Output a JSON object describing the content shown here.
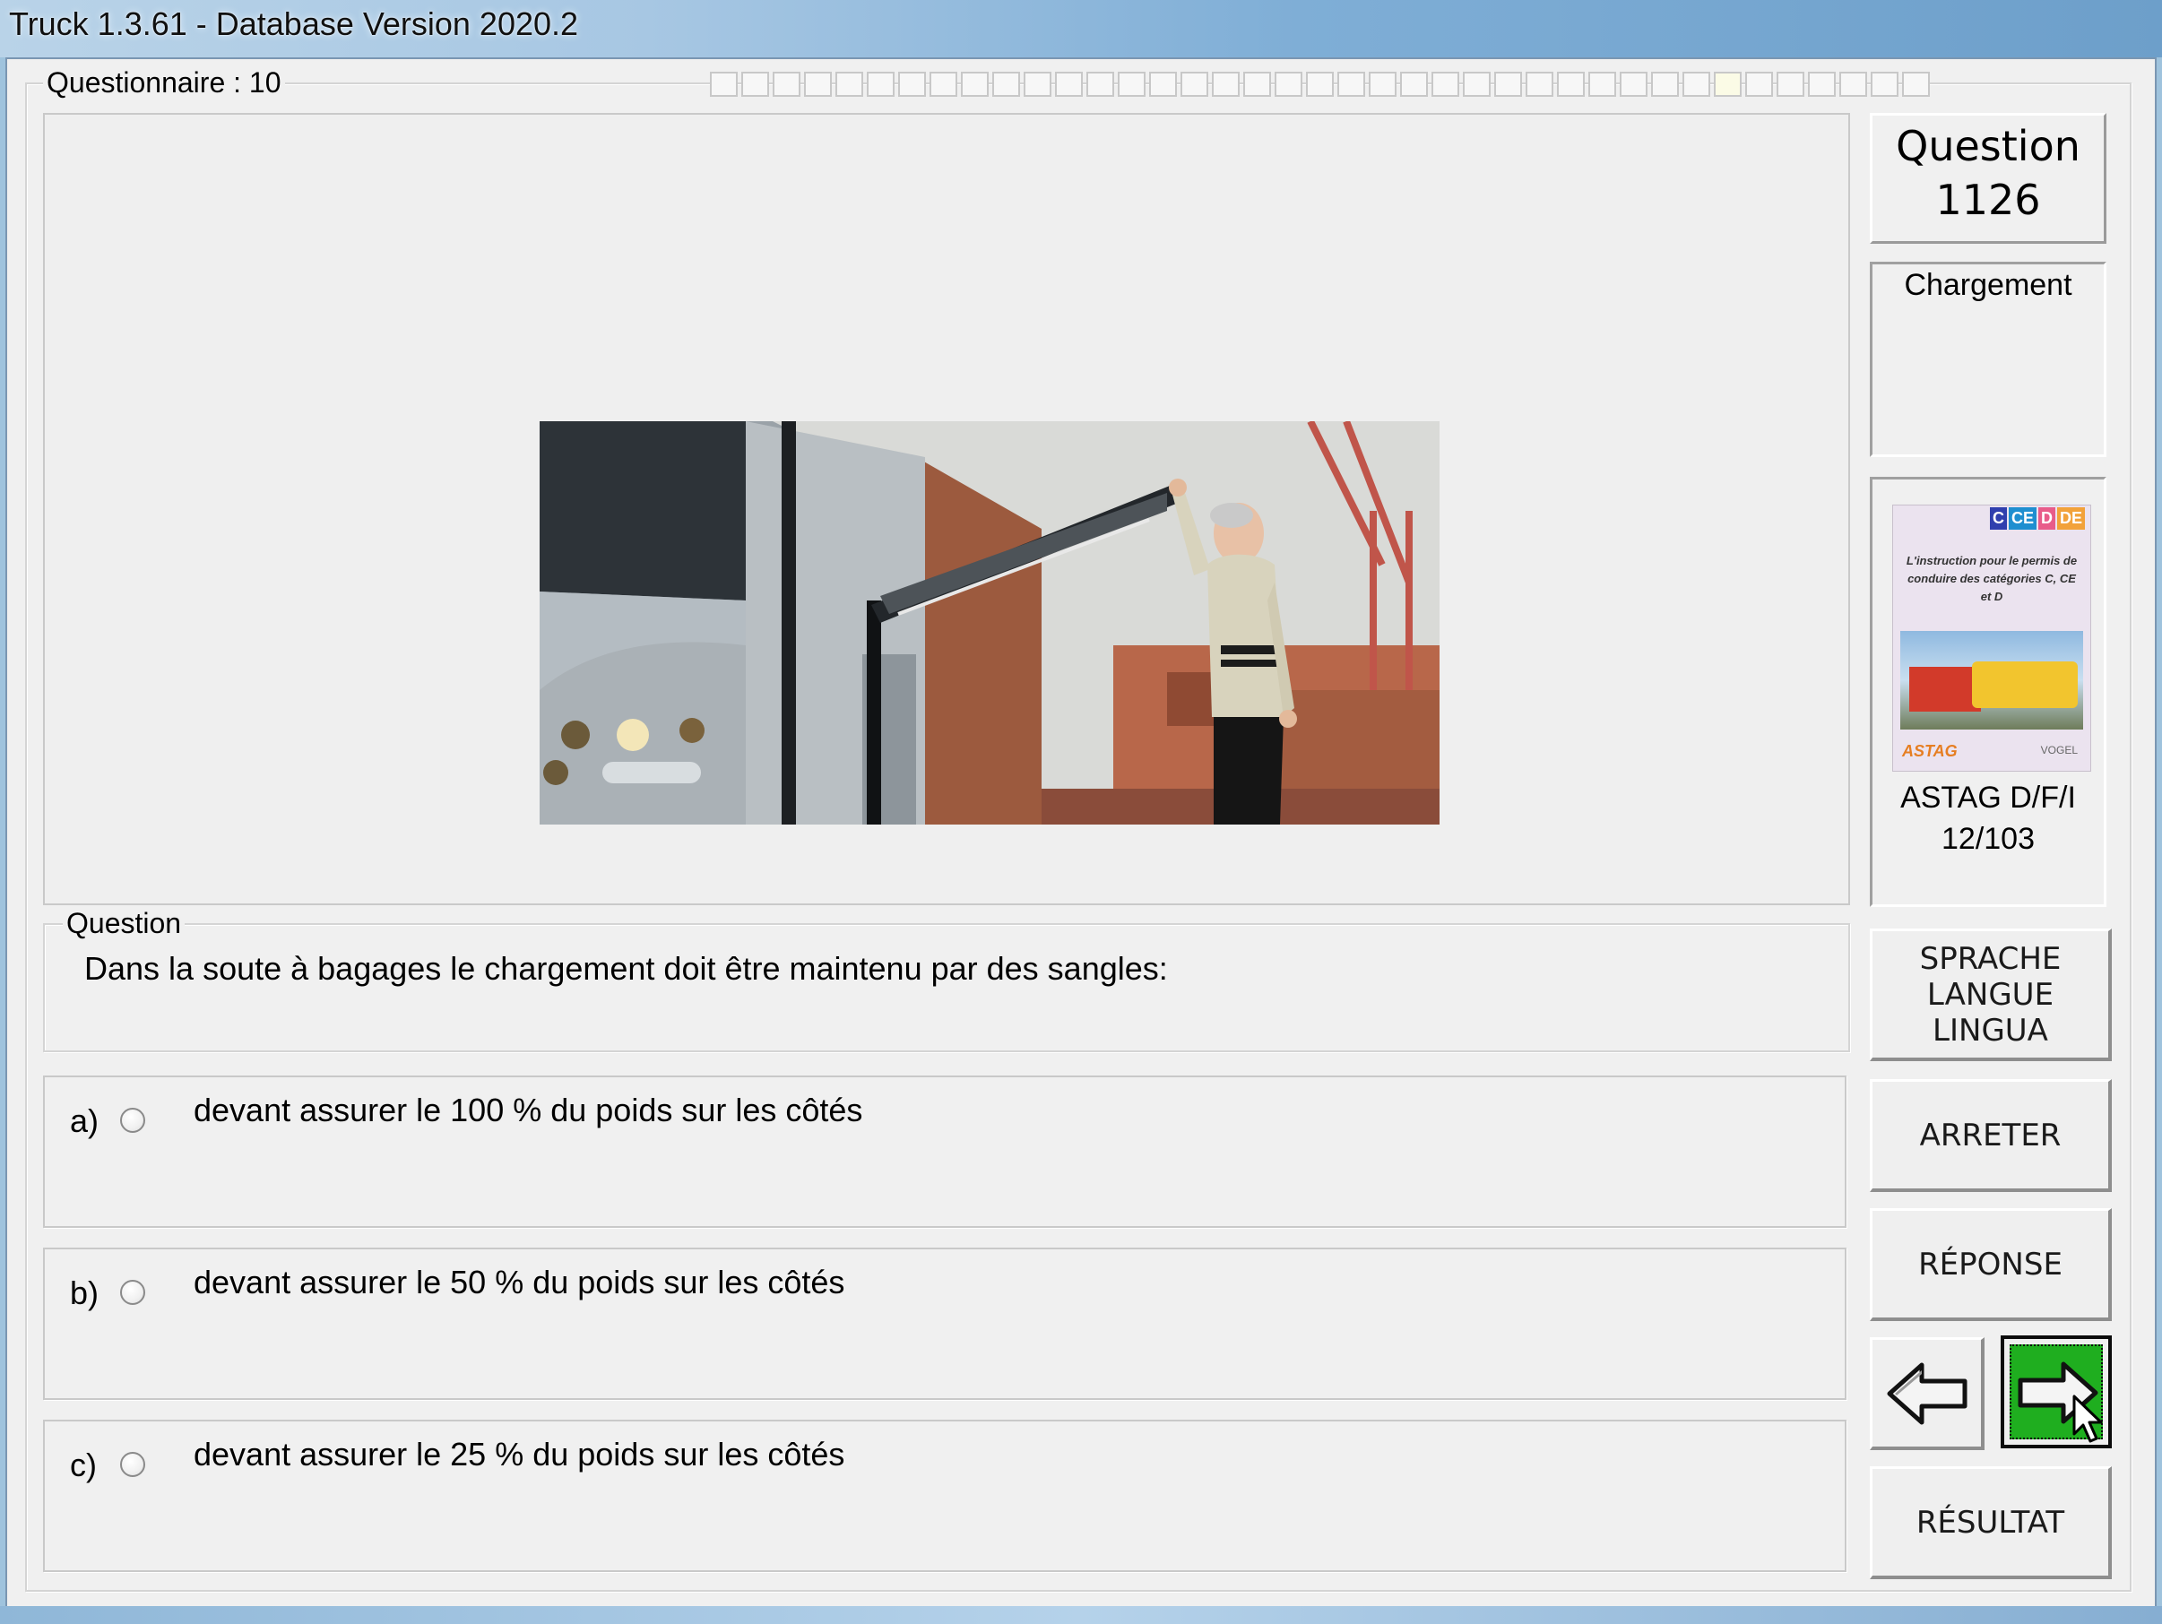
{
  "window": {
    "title": "Truck 1.3.61 - Database Version 2020.2"
  },
  "questionnaire": {
    "label": "Questionnaire : 10",
    "cells_total": 39,
    "cells_answered": 0
  },
  "question_number": {
    "label": "Question",
    "number": "1126"
  },
  "category": {
    "label": "Chargement"
  },
  "book": {
    "cover_tags": [
      "C",
      "CE",
      "D",
      "DE"
    ],
    "cover_tag_colors": [
      "#2f3fae",
      "#1f8fd0",
      "#e85c8a",
      "#f2a23a"
    ],
    "cover_text": "L'instruction pour le permis de conduire des catégories C, CE et D",
    "publisher_logo": "ASTAG",
    "publisher_logo2": "VOGEL",
    "source": "ASTAG D/F/I",
    "reference": "12/103"
  },
  "question": {
    "group_label": "Question",
    "text": "Dans la soute à bagages le chargement doit être maintenu par des sangles:"
  },
  "answers": [
    {
      "letter": "a)",
      "text": "devant assurer le 100 % du poids sur les côtés",
      "selected": false
    },
    {
      "letter": "b)",
      "text": "devant assurer le 50 % du poids sur les côtés",
      "selected": false
    },
    {
      "letter": "c)",
      "text": "devant assurer le 25 % du poids sur les côtés",
      "selected": false
    }
  ],
  "buttons": {
    "language_lines": [
      "SPRACHE",
      "LANGUE",
      "LINGUA"
    ],
    "stop": "ARRETER",
    "answer": "RÉPONSE",
    "result": "RÉSULTAT",
    "prev_icon": "arrow-left-icon",
    "next_icon": "arrow-right-icon"
  },
  "colors": {
    "next_button": "#1fae1f",
    "titlebar": "#7faed6"
  }
}
